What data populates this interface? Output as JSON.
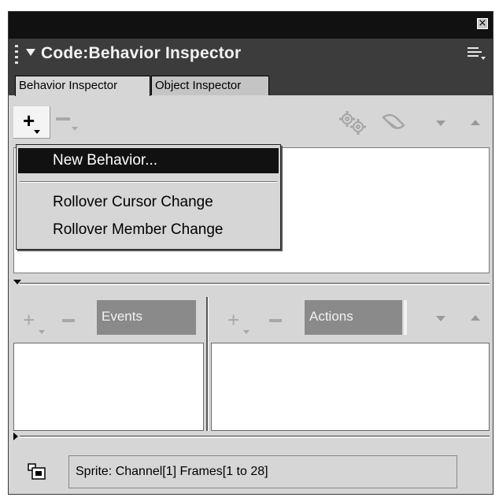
{
  "window": {
    "close_glyph": "×"
  },
  "panel": {
    "title": "Code:Behavior Inspector"
  },
  "tabs": [
    {
      "label": "Behavior Inspector",
      "active": true
    },
    {
      "label": "Object Inspector",
      "active": false
    }
  ],
  "toolbar": {
    "add_glyph": "+",
    "remove_glyph": "−"
  },
  "behavior_menu": {
    "items": [
      "New Behavior...",
      "Rollover Cursor Change",
      "Rollover Member Change"
    ],
    "highlighted_index": 0
  },
  "events_panel": {
    "label": "Events"
  },
  "actions_panel": {
    "label": "Actions"
  },
  "status": {
    "text": "Sprite:  Channel[1]  Frames[1 to 28]"
  },
  "colors": {
    "menu_highlight": "#111111",
    "panel_header": "#3c3c3c",
    "label_fill": "#8a8a8a"
  }
}
